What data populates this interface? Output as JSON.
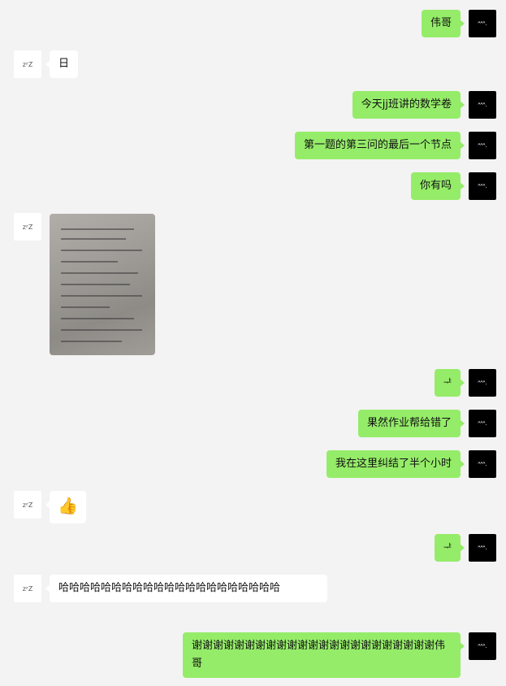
{
  "me_avatar_text": "ᴬᴬᴬ.",
  "other_avatar_text": "zᶻZ",
  "messages": [
    {
      "text": "伟哥"
    },
    {
      "text": "日"
    },
    {
      "text": "今天jj班讲的数学卷"
    },
    {
      "text": "第一题的第三问的最后一个节点"
    },
    {
      "text": "你有吗"
    },
    {
      "text": "ᅷ"
    },
    {
      "text": "果然作业帮给错了"
    },
    {
      "text": "我在这里纠结了半个小时"
    },
    {
      "text": "👍"
    },
    {
      "text": "ᅷ"
    },
    {
      "text": "哈哈哈哈哈哈哈哈哈哈哈哈哈哈哈哈哈哈哈哈哈"
    },
    {
      "text": "谢谢谢谢谢谢谢谢谢谢谢谢谢谢谢谢谢谢谢谢谢谢谢伟哥"
    }
  ]
}
